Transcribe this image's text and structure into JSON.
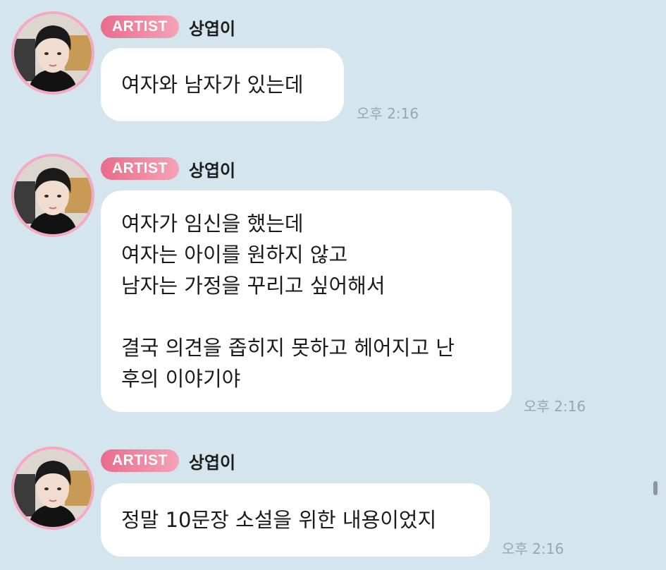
{
  "messages": [
    {
      "badge": "ARTIST",
      "sender": "상엽이",
      "lines": [
        "여자와 남자가 있는데"
      ],
      "time": "오후 2:16"
    },
    {
      "badge": "ARTIST",
      "sender": "상엽이",
      "lines": [
        "여자가 임신을 했는데",
        "여자는 아이를 원하지 않고",
        "남자는 가정을 꾸리고 싶어해서",
        "",
        "결국 의견을 좁히지 못하고 헤어지고 난",
        "후의 이야기야"
      ],
      "time": "오후 2:16"
    },
    {
      "badge": "ARTIST",
      "sender": "상엽이",
      "lines": [
        "정말 10문장 소설을 위한 내용이었지"
      ],
      "time": "오후 2:16"
    }
  ],
  "colors": {
    "background": "#d5e5ee",
    "badge": "#e96c8c",
    "avatar_ring": "#f3a9c3",
    "bubble": "#ffffff",
    "timestamp": "#9aa6ad"
  }
}
